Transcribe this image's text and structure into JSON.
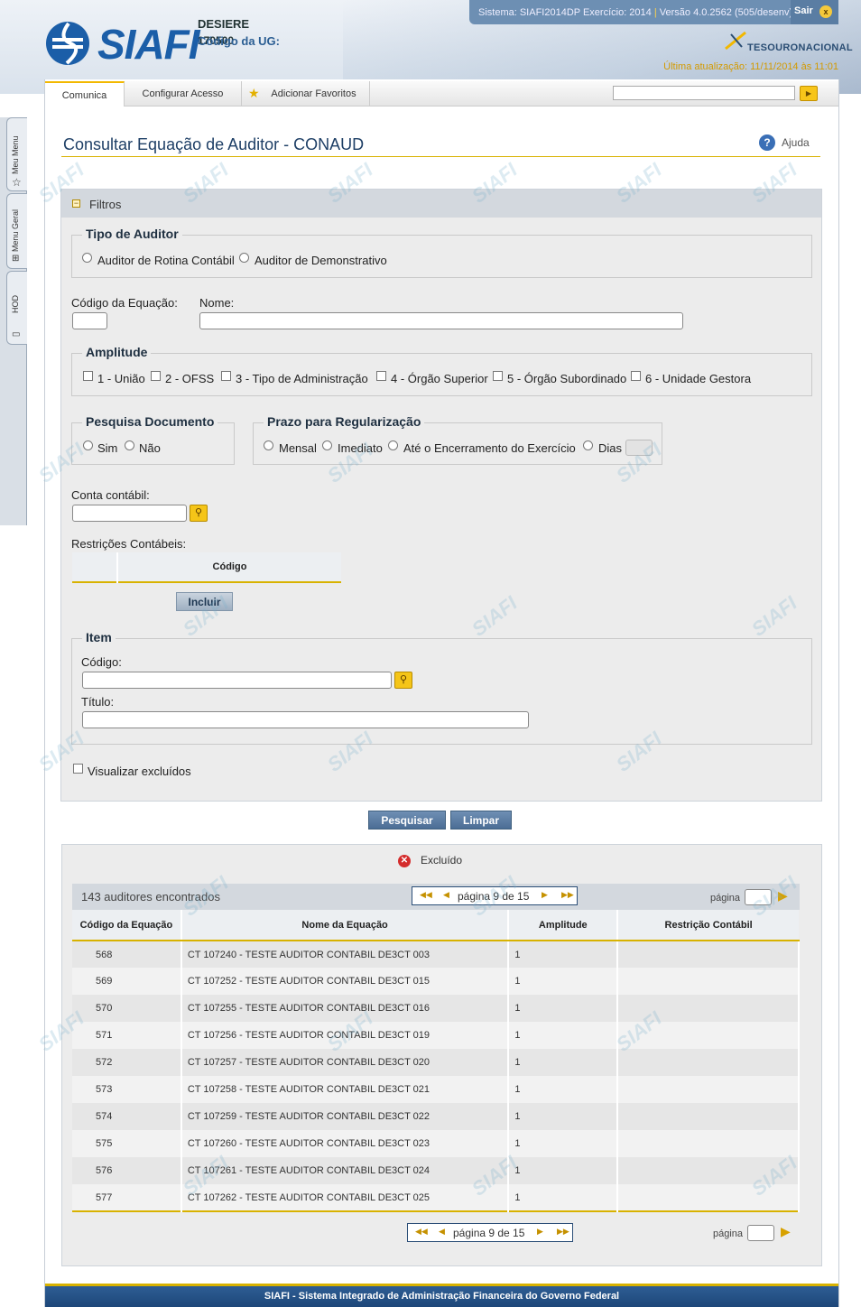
{
  "header": {
    "logo_text": "SIAFI",
    "user_name": "DESIERE",
    "ug_label": "Código da UG:",
    "ug_value": "170500",
    "system_info": "Sistema: SIAFI2014DP Exercício: 2014",
    "separator": "|",
    "version_info": "Versão 4.0.2562 (505/desenv)",
    "logout_label": "Sair",
    "logout_icon": "close-icon",
    "tesouro_text": "TESOURONACIONAL",
    "last_update": "Última atualização: 11/11/2014 às 11:01"
  },
  "sidebar": {
    "tabs": [
      {
        "label": "Meu Menu",
        "icon": "star-icon"
      },
      {
        "label": "Menu Geral",
        "icon": "sitemap-icon"
      },
      {
        "label": "HOD",
        "icon": "monitor-icon"
      }
    ]
  },
  "menubar": {
    "items": [
      "Comunica",
      "Configurar Acesso",
      "Adicionar Favoritos"
    ],
    "search_value": "",
    "search_go": "▶"
  },
  "page": {
    "title": "Consultar Equação de Auditor - CONAUD",
    "help_label": "Ajuda"
  },
  "filters": {
    "title": "Filtros",
    "toggle": "−",
    "tipo_auditor": {
      "legend": "Tipo de Auditor",
      "options": [
        "Auditor de Rotina Contábil",
        "Auditor de Demonstrativo"
      ]
    },
    "codigo_label": "Código da Equação:",
    "nome_label": "Nome:",
    "amplitude": {
      "legend": "Amplitude",
      "options": [
        "1 - União",
        "2 - OFSS",
        "3 - Tipo de Administração",
        "4 - Órgão Superior",
        "5 - Órgão Subordinado",
        "6 - Unidade Gestora"
      ]
    },
    "pesquisa_documento": {
      "legend": "Pesquisa Documento",
      "options": [
        "Sim",
        "Não"
      ]
    },
    "prazo": {
      "legend": "Prazo para Regularização",
      "options": [
        "Mensal",
        "Imediato",
        "Até o Encerramento do Exercício",
        "Dias"
      ]
    },
    "conta_label": "Conta contábil:",
    "restricoes_label": "Restrições Contábeis:",
    "restricoes_col": "Código",
    "incluir_label": "Incluir",
    "item": {
      "legend": "Item",
      "codigo_label": "Código:",
      "titulo_label": "Título:"
    },
    "visualizar_excluidos": "Visualizar excluídos"
  },
  "actions": {
    "pesquisar": "Pesquisar",
    "limpar": "Limpar"
  },
  "results": {
    "legend_excluido": "Excluído",
    "count_text": "143 auditores encontrados",
    "pager_text": "página 9 de 15",
    "page_label": "página",
    "columns": [
      "Código da Equação",
      "Nome da Equação",
      "Amplitude",
      "Restrição Contábil"
    ],
    "rows": [
      {
        "codigo": "568",
        "nome": "CT 107240 - TESTE AUDITOR CONTABIL DE3CT 003",
        "amplitude": "1",
        "restricao": ""
      },
      {
        "codigo": "569",
        "nome": "CT 107252 - TESTE AUDITOR CONTABIL DE3CT 015",
        "amplitude": "1",
        "restricao": ""
      },
      {
        "codigo": "570",
        "nome": "CT 107255 - TESTE AUDITOR CONTABIL DE3CT 016",
        "amplitude": "1",
        "restricao": ""
      },
      {
        "codigo": "571",
        "nome": "CT 107256 - TESTE AUDITOR CONTABIL DE3CT 019",
        "amplitude": "1",
        "restricao": ""
      },
      {
        "codigo": "572",
        "nome": "CT 107257 - TESTE AUDITOR CONTABIL DE3CT 020",
        "amplitude": "1",
        "restricao": ""
      },
      {
        "codigo": "573",
        "nome": "CT 107258 - TESTE AUDITOR CONTABIL DE3CT 021",
        "amplitude": "1",
        "restricao": ""
      },
      {
        "codigo": "574",
        "nome": "CT 107259 - TESTE AUDITOR CONTABIL DE3CT 022",
        "amplitude": "1",
        "restricao": ""
      },
      {
        "codigo": "575",
        "nome": "CT 107260 - TESTE AUDITOR CONTABIL DE3CT 023",
        "amplitude": "1",
        "restricao": ""
      },
      {
        "codigo": "576",
        "nome": "CT 107261 - TESTE AUDITOR CONTABIL DE3CT 024",
        "amplitude": "1",
        "restricao": ""
      },
      {
        "codigo": "577",
        "nome": "CT 107262 - TESTE AUDITOR CONTABIL DE3CT 025",
        "amplitude": "1",
        "restricao": ""
      }
    ]
  },
  "footer": {
    "text": "SIAFI - Sistema Integrado de Administração Financeira do Governo Federal"
  },
  "colors": {
    "brand_blue": "#1b5ea8",
    "accent_yellow": "#d8b200",
    "button_blue": "#4b6d95"
  }
}
